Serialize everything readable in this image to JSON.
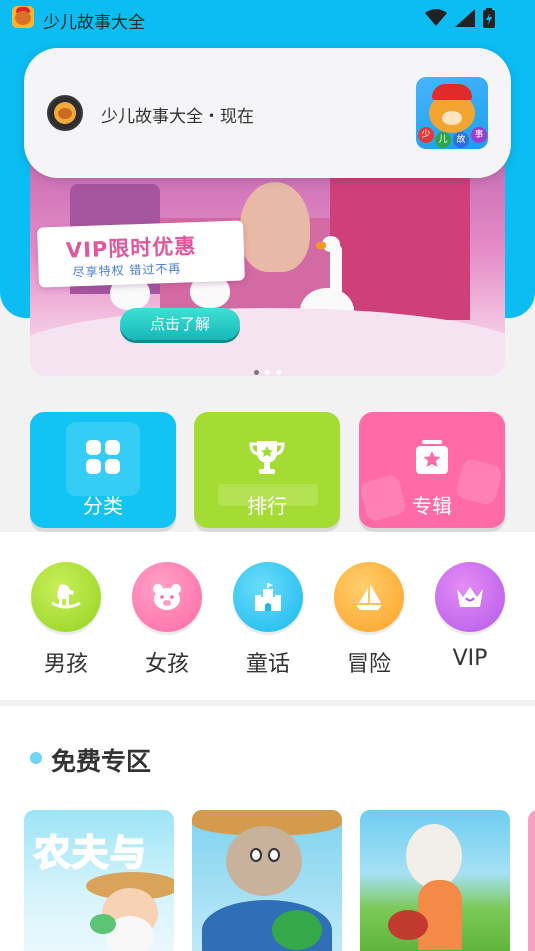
{
  "status_bar": {
    "app_name": "少儿故事大全",
    "icons": [
      "wifi-icon",
      "cellular-signal-icon",
      "battery-charging-icon"
    ]
  },
  "notification": {
    "text": "少儿故事大全・现在",
    "thumbnail_balls": [
      "少",
      "儿",
      "故",
      "事"
    ]
  },
  "banner": {
    "title": "VIP限时优惠",
    "subtitle": "尽享特权  错过不再",
    "cta": "点击了解",
    "page_count": 3,
    "active_page": 1
  },
  "tiles": [
    {
      "label": "分类",
      "icon": "grid-icon",
      "color": "#12c3f4"
    },
    {
      "label": "排行",
      "icon": "trophy-icon",
      "color": "#a5dc34"
    },
    {
      "label": "专辑",
      "icon": "album-star-icon",
      "color": "#ff6aa7"
    }
  ],
  "round_buttons": [
    {
      "label": "男孩",
      "icon": "rocking-horse-icon"
    },
    {
      "label": "女孩",
      "icon": "bear-face-icon"
    },
    {
      "label": "童话",
      "icon": "castle-icon"
    },
    {
      "label": "冒险",
      "icon": "sailboat-icon"
    },
    {
      "label": "VIP",
      "icon": "crown-icon"
    }
  ],
  "free_zone": {
    "title": "免费专区",
    "cards": [
      {
        "cover_text": "农夫与"
      },
      {
        "cover_text": ""
      },
      {
        "cover_text": ""
      }
    ]
  }
}
